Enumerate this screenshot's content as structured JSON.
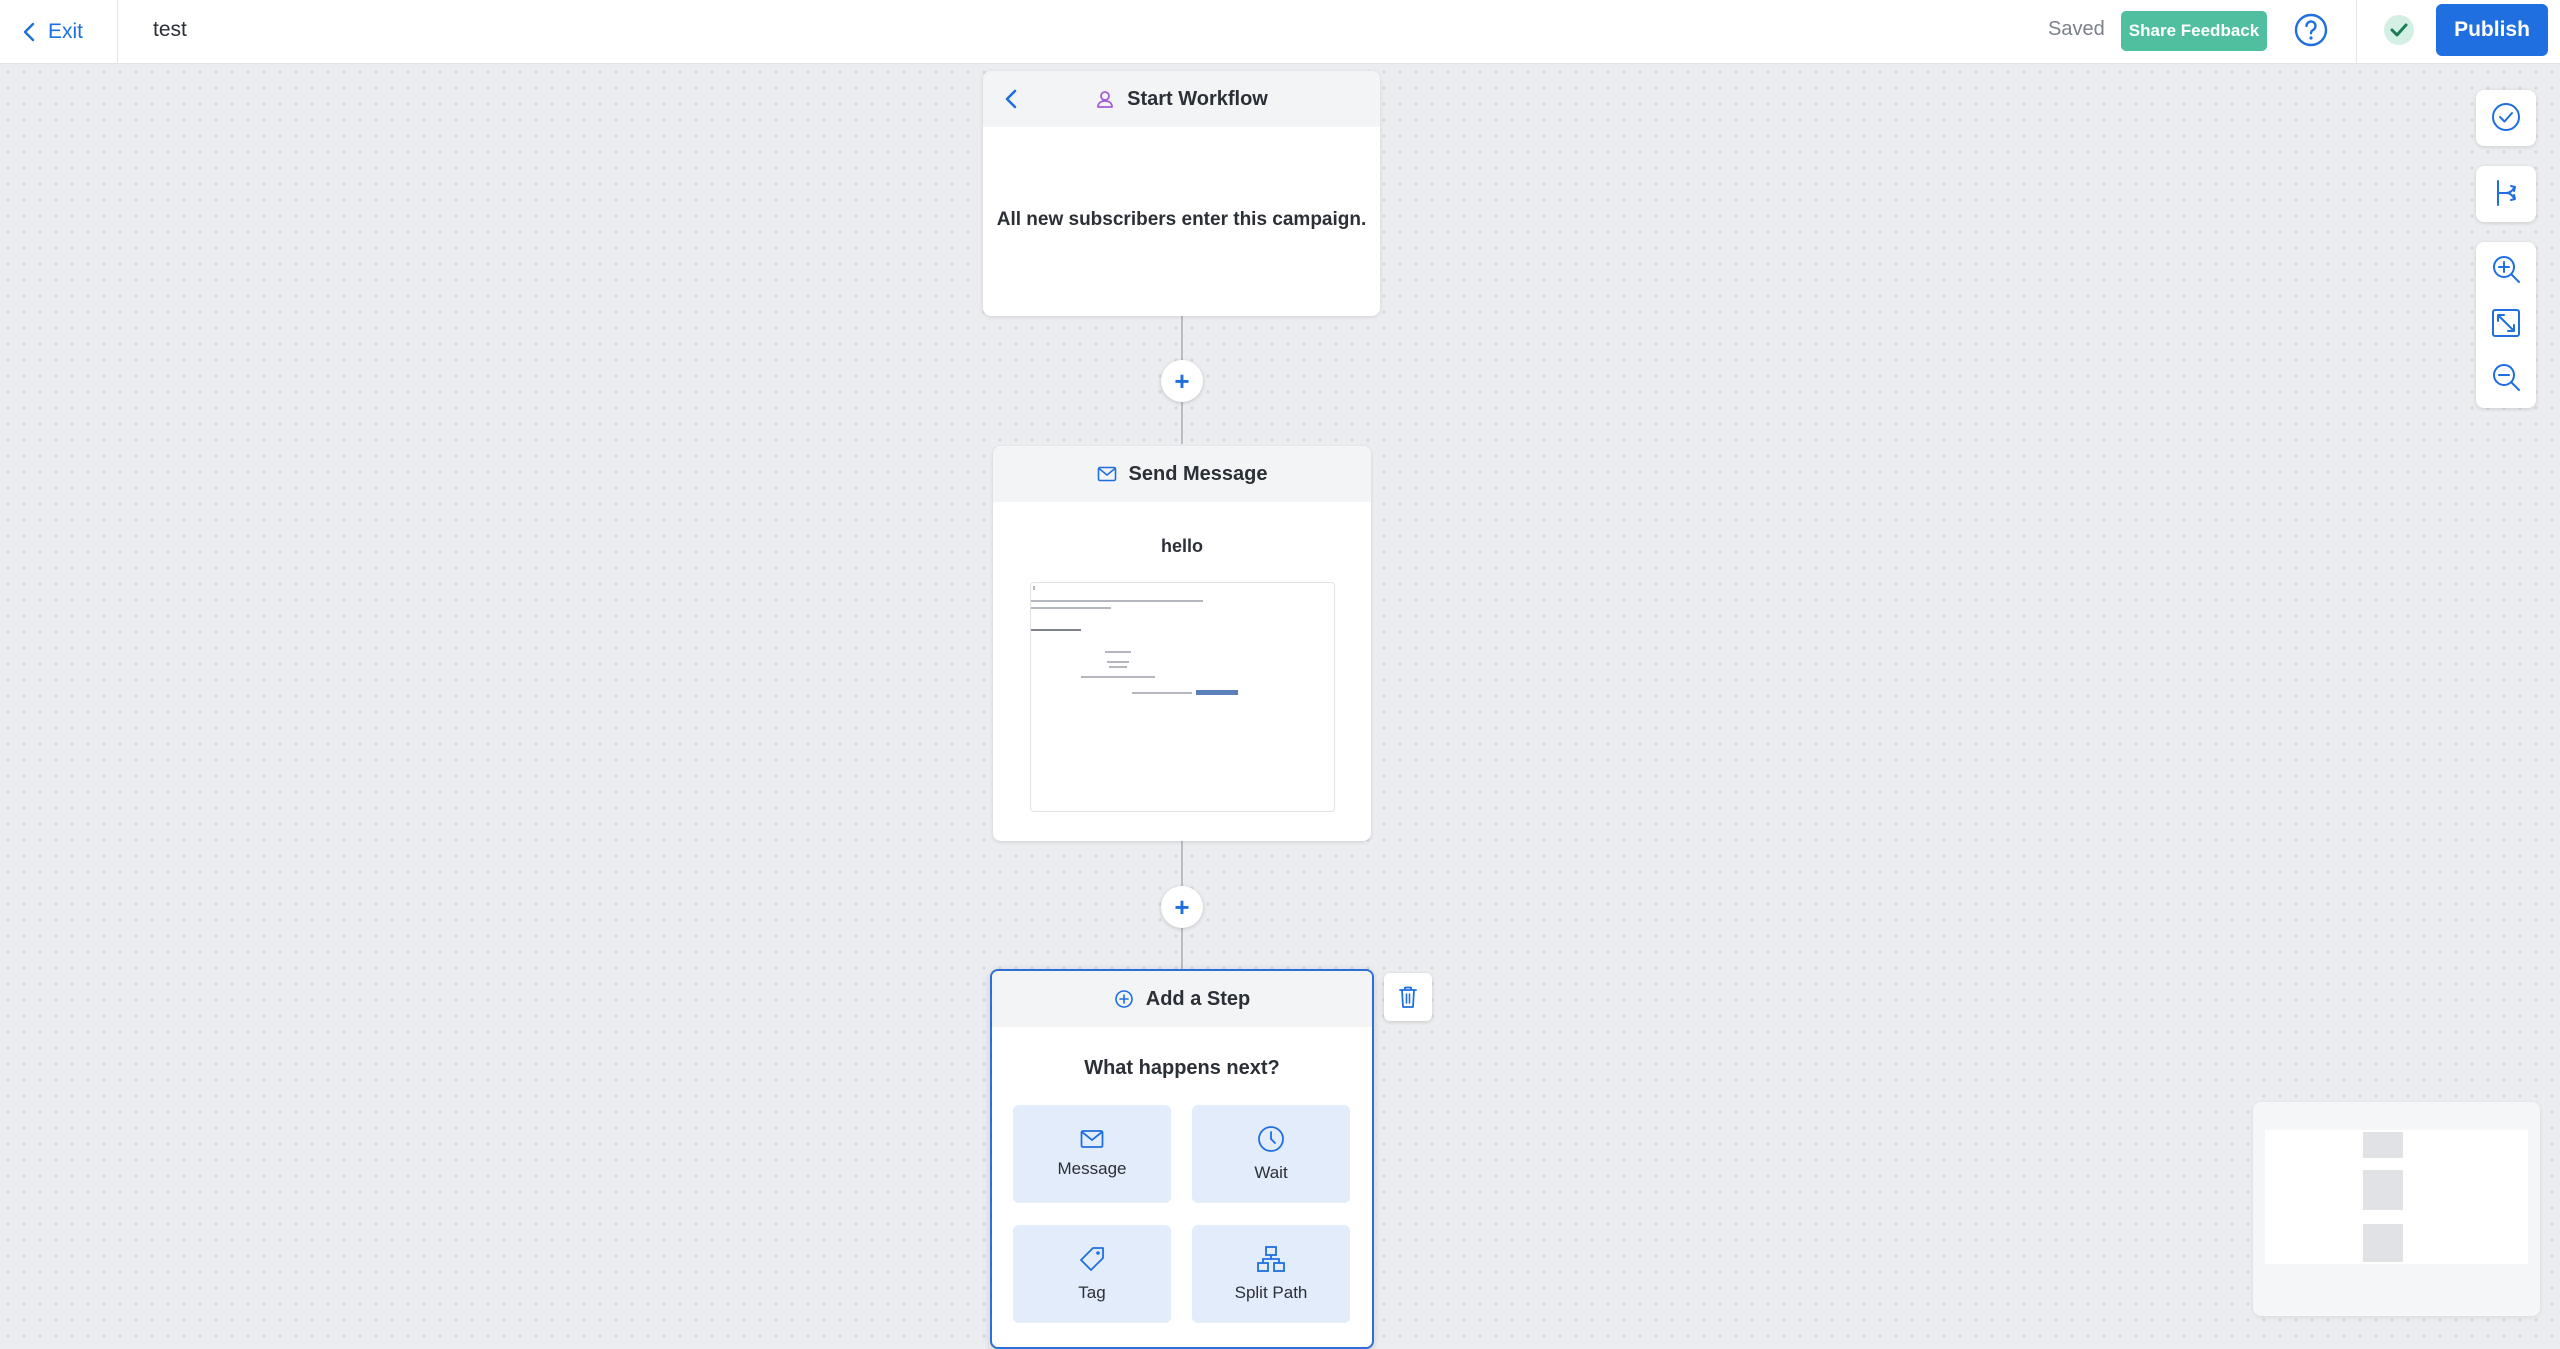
{
  "header": {
    "exit_label": "Exit",
    "workflow_title": "test",
    "saved_status": "Saved",
    "feedback_label": "Share Feedback",
    "publish_label": "Publish"
  },
  "nodes": {
    "start": {
      "title": "Start Workflow",
      "description": "All new subscribers enter this campaign."
    },
    "message": {
      "title": "Send Message",
      "subject": "hello"
    },
    "add_step": {
      "title": "Add a Step",
      "question": "What happens next?",
      "options": [
        {
          "label": "Message",
          "icon": "envelope-icon"
        },
        {
          "label": "Wait",
          "icon": "clock-icon"
        },
        {
          "label": "Tag",
          "icon": "tag-icon"
        },
        {
          "label": "Split Path",
          "icon": "split-path-icon"
        }
      ]
    }
  },
  "toolbar": {
    "icons": [
      "check-circle-icon",
      "branch-icon",
      "zoom-in-icon",
      "fit-screen-icon",
      "zoom-out-icon"
    ]
  },
  "colors": {
    "accent": "#1f6fe0",
    "feedback": "#4fbf9f",
    "option_bg": "#e3ecfa",
    "canvas": "#ecedf0"
  }
}
